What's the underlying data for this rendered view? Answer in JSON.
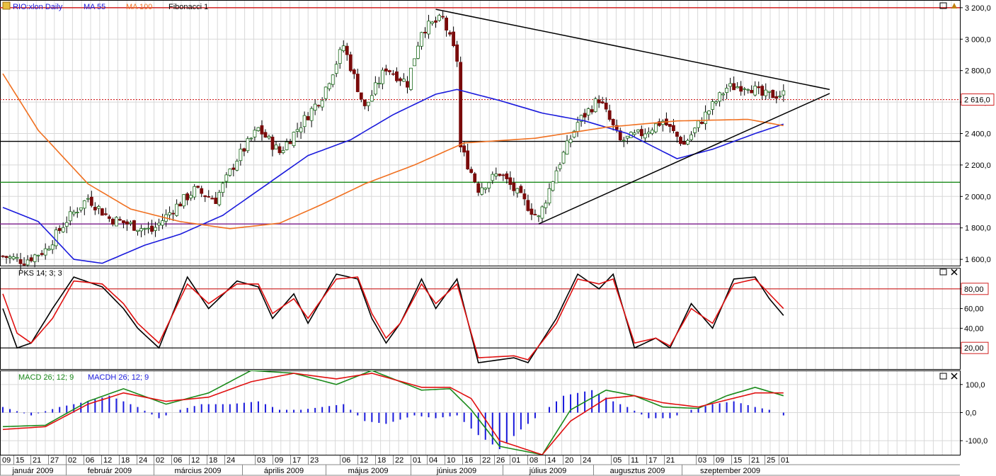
{
  "legend": {
    "symbol": "RIO:xlon Daily",
    "ma55": "MA 55",
    "ma100": "MA 100",
    "fib": "Fibonacci 1"
  },
  "indicators": {
    "stoch": "PKS 14; 3; 3",
    "macd": "MACD 26; 12; 9",
    "macdh": "MACDH 26; 12; 9"
  },
  "colors": {
    "ma55": "#1a1adc",
    "ma100": "#f07020",
    "stoch_k": "#000000",
    "stoch_d": "#e01010",
    "macd": "#1a8a1a",
    "signal": "#e01010",
    "hist": "#1a1adc"
  },
  "chart_data": [
    {
      "type": "candlestick",
      "name": "price",
      "y_ticks": [
        "3 200,0",
        "3 000,0",
        "2 800,0",
        "2 600,0",
        "2 400,0",
        "2 200,0",
        "2 000,0",
        "1 800,0",
        "1 600,0"
      ],
      "y_tick_values": [
        3200,
        3000,
        2800,
        2600,
        2400,
        2200,
        2000,
        1800,
        1600
      ],
      "ylim": [
        1560,
        3240
      ],
      "last_price": 2616,
      "last_price_label": "2 616,0",
      "horizontal_levels": [
        {
          "value": 3200,
          "color": "#d02020"
        },
        {
          "value": 2616,
          "color": "#d02020",
          "dashed": true
        },
        {
          "value": 2350,
          "color": "#000000"
        },
        {
          "value": 2090,
          "color": "#1a8a1a"
        },
        {
          "value": 1825,
          "color": "#7a1a8a"
        }
      ],
      "trendlines": [
        {
          "from": [
            122,
            3190
          ],
          "to": [
            233,
            2680
          ]
        },
        {
          "from": [
            151,
            1825
          ],
          "to": [
            233,
            2655
          ]
        }
      ],
      "closes_anchor": [
        [
          0,
          1620
        ],
        [
          6,
          1590
        ],
        [
          12,
          1660
        ],
        [
          18,
          1850
        ],
        [
          24,
          1990
        ],
        [
          30,
          1860
        ],
        [
          36,
          1820
        ],
        [
          42,
          1780
        ],
        [
          48,
          1920
        ],
        [
          54,
          2040
        ],
        [
          60,
          1980
        ],
        [
          66,
          2240
        ],
        [
          72,
          2430
        ],
        [
          78,
          2280
        ],
        [
          84,
          2460
        ],
        [
          90,
          2640
        ],
        [
          96,
          2960
        ],
        [
          102,
          2560
        ],
        [
          108,
          2820
        ],
        [
          114,
          2720
        ],
        [
          118,
          3060
        ],
        [
          124,
          3130
        ],
        [
          128,
          2870
        ],
        [
          129,
          2310
        ],
        [
          134,
          2050
        ],
        [
          140,
          2150
        ],
        [
          146,
          1990
        ],
        [
          151,
          1860
        ],
        [
          156,
          2170
        ],
        [
          162,
          2470
        ],
        [
          168,
          2620
        ],
        [
          174,
          2350
        ],
        [
          180,
          2400
        ],
        [
          186,
          2480
        ],
        [
          192,
          2330
        ],
        [
          198,
          2520
        ],
        [
          204,
          2690
        ],
        [
          210,
          2710
        ],
        [
          214,
          2640
        ],
        [
          220,
          2650
        ]
      ],
      "ma55": [
        [
          0,
          1930
        ],
        [
          10,
          1840
        ],
        [
          20,
          1600
        ],
        [
          28,
          1575
        ],
        [
          40,
          1690
        ],
        [
          50,
          1760
        ],
        [
          62,
          1880
        ],
        [
          74,
          2070
        ],
        [
          86,
          2260
        ],
        [
          98,
          2360
        ],
        [
          110,
          2520
        ],
        [
          122,
          2650
        ],
        [
          128,
          2680
        ],
        [
          140,
          2610
        ],
        [
          152,
          2530
        ],
        [
          164,
          2480
        ],
        [
          176,
          2400
        ],
        [
          190,
          2240
        ],
        [
          200,
          2300
        ],
        [
          212,
          2400
        ],
        [
          220,
          2460
        ]
      ],
      "ma100": [
        [
          0,
          2780
        ],
        [
          10,
          2420
        ],
        [
          24,
          2080
        ],
        [
          36,
          1920
        ],
        [
          50,
          1840
        ],
        [
          64,
          1795
        ],
        [
          78,
          1830
        ],
        [
          90,
          1950
        ],
        [
          102,
          2080
        ],
        [
          116,
          2200
        ],
        [
          130,
          2340
        ],
        [
          150,
          2370
        ],
        [
          170,
          2440
        ],
        [
          190,
          2480
        ],
        [
          210,
          2490
        ],
        [
          220,
          2450
        ]
      ]
    },
    {
      "type": "line",
      "name": "stochastic",
      "y_ticks": [
        "80,00",
        "60,00",
        "40,00",
        "20,00"
      ],
      "y_tick_values": [
        80,
        60,
        40,
        20
      ],
      "ylim": [
        0,
        100
      ],
      "levels": [
        80,
        20
      ],
      "last_k": 53,
      "series": [
        {
          "key": "k",
          "values": [
            [
              0,
              60
            ],
            [
              4,
              20
            ],
            [
              8,
              25
            ],
            [
              14,
              60
            ],
            [
              20,
              92
            ],
            [
              28,
              82
            ],
            [
              34,
              60
            ],
            [
              38,
              40
            ],
            [
              44,
              20
            ],
            [
              52,
              92
            ],
            [
              58,
              60
            ],
            [
              66,
              88
            ],
            [
              72,
              82
            ],
            [
              76,
              50
            ],
            [
              82,
              75
            ],
            [
              86,
              45
            ],
            [
              94,
              95
            ],
            [
              100,
              90
            ],
            [
              104,
              50
            ],
            [
              108,
              25
            ],
            [
              112,
              45
            ],
            [
              118,
              90
            ],
            [
              122,
              60
            ],
            [
              128,
              90
            ],
            [
              134,
              5
            ],
            [
              144,
              10
            ],
            [
              148,
              5
            ],
            [
              156,
              50
            ],
            [
              162,
              95
            ],
            [
              168,
              80
            ],
            [
              172,
              95
            ],
            [
              178,
              20
            ],
            [
              184,
              30
            ],
            [
              188,
              20
            ],
            [
              194,
              65
            ],
            [
              200,
              40
            ],
            [
              206,
              90
            ],
            [
              212,
              92
            ],
            [
              216,
              70
            ],
            [
              220,
              53
            ]
          ]
        },
        {
          "key": "d",
          "values": [
            [
              0,
              75
            ],
            [
              4,
              35
            ],
            [
              8,
              25
            ],
            [
              14,
              50
            ],
            [
              20,
              88
            ],
            [
              28,
              85
            ],
            [
              34,
              65
            ],
            [
              38,
              45
            ],
            [
              44,
              25
            ],
            [
              52,
              85
            ],
            [
              58,
              65
            ],
            [
              66,
              85
            ],
            [
              72,
              85
            ],
            [
              76,
              55
            ],
            [
              82,
              70
            ],
            [
              86,
              50
            ],
            [
              94,
              90
            ],
            [
              100,
              92
            ],
            [
              104,
              55
            ],
            [
              108,
              30
            ],
            [
              112,
              45
            ],
            [
              118,
              85
            ],
            [
              122,
              65
            ],
            [
              128,
              85
            ],
            [
              134,
              10
            ],
            [
              144,
              12
            ],
            [
              148,
              8
            ],
            [
              156,
              45
            ],
            [
              162,
              90
            ],
            [
              168,
              85
            ],
            [
              172,
              90
            ],
            [
              178,
              25
            ],
            [
              184,
              30
            ],
            [
              188,
              22
            ],
            [
              194,
              60
            ],
            [
              200,
              45
            ],
            [
              206,
              85
            ],
            [
              212,
              90
            ],
            [
              216,
              75
            ],
            [
              220,
              60
            ]
          ]
        }
      ]
    },
    {
      "type": "line+bar",
      "name": "macd",
      "y_ticks": [
        "100,0",
        "0,0",
        "-100,0"
      ],
      "y_tick_values": [
        100,
        0,
        -100
      ],
      "ylim": [
        -150,
        150
      ],
      "series": [
        {
          "key": "macd",
          "values": [
            [
              0,
              -50
            ],
            [
              12,
              -45
            ],
            [
              24,
              40
            ],
            [
              34,
              85
            ],
            [
              46,
              30
            ],
            [
              58,
              70
            ],
            [
              70,
              150
            ],
            [
              82,
              140
            ],
            [
              94,
              100
            ],
            [
              104,
              150
            ],
            [
              118,
              80
            ],
            [
              126,
              85
            ],
            [
              132,
              10
            ],
            [
              140,
              -120
            ],
            [
              152,
              -150
            ],
            [
              160,
              10
            ],
            [
              170,
              80
            ],
            [
              178,
              60
            ],
            [
              186,
              20
            ],
            [
              196,
              15
            ],
            [
              204,
              60
            ],
            [
              212,
              90
            ],
            [
              220,
              60
            ]
          ]
        },
        {
          "key": "signal",
          "values": [
            [
              0,
              -60
            ],
            [
              12,
              -50
            ],
            [
              24,
              30
            ],
            [
              34,
              70
            ],
            [
              46,
              40
            ],
            [
              58,
              55
            ],
            [
              70,
              110
            ],
            [
              82,
              140
            ],
            [
              94,
              120
            ],
            [
              104,
              140
            ],
            [
              118,
              90
            ],
            [
              126,
              90
            ],
            [
              132,
              50
            ],
            [
              140,
              -100
            ],
            [
              152,
              -150
            ],
            [
              160,
              -30
            ],
            [
              170,
              50
            ],
            [
              178,
              60
            ],
            [
              186,
              35
            ],
            [
              196,
              20
            ],
            [
              204,
              45
            ],
            [
              212,
              70
            ],
            [
              220,
              70
            ]
          ]
        },
        {
          "key": "hist",
          "values": [
            [
              0,
              20
            ],
            [
              8,
              -10
            ],
            [
              16,
              20
            ],
            [
              24,
              40
            ],
            [
              30,
              60
            ],
            [
              38,
              20
            ],
            [
              44,
              -20
            ],
            [
              50,
              10
            ],
            [
              56,
              30
            ],
            [
              64,
              30
            ],
            [
              72,
              40
            ],
            [
              78,
              10
            ],
            [
              84,
              10
            ],
            [
              90,
              20
            ],
            [
              96,
              30
            ],
            [
              102,
              -30
            ],
            [
              108,
              -40
            ],
            [
              116,
              -10
            ],
            [
              122,
              -20
            ],
            [
              128,
              -10
            ],
            [
              134,
              -80
            ],
            [
              140,
              -130
            ],
            [
              146,
              -60
            ],
            [
              152,
              0
            ],
            [
              158,
              60
            ],
            [
              162,
              70
            ],
            [
              166,
              80
            ],
            [
              172,
              40
            ],
            [
              176,
              20
            ],
            [
              182,
              -20
            ],
            [
              188,
              -20
            ],
            [
              194,
              10
            ],
            [
              200,
              30
            ],
            [
              206,
              40
            ],
            [
              212,
              20
            ],
            [
              216,
              10
            ],
            [
              220,
              -10
            ]
          ]
        }
      ]
    }
  ],
  "x_axis": {
    "days": [
      "09",
      "15",
      "21",
      "27",
      "02",
      "06",
      "12",
      "18",
      "24",
      "02",
      "06",
      "12",
      "18",
      "24",
      "03",
      "09",
      "17",
      "23",
      "06",
      "12",
      "18",
      "22",
      "01",
      "04",
      "10",
      "16",
      "22",
      "26",
      "01",
      "08",
      "14",
      "20",
      "24",
      "05",
      "11",
      "17",
      "21",
      "03",
      "09",
      "15",
      "21",
      "25",
      "01"
    ],
    "months": [
      "január 2009",
      "február 2009",
      "március 2009",
      "április 2009",
      "május 2009",
      "június 2009",
      "július 2009",
      "augusztus 2009",
      "szeptember 2009"
    ]
  }
}
